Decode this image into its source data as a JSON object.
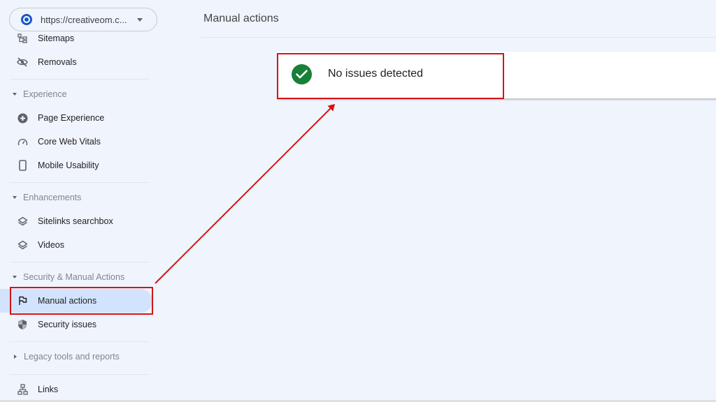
{
  "property": {
    "url": "https://creativeom.c...",
    "logo_icon": "property-logo-icon",
    "caret_icon": "caret-down-icon"
  },
  "sidebar": {
    "items_top": [
      {
        "label": "Sitemaps",
        "icon": "sitemap-icon"
      },
      {
        "label": "Removals",
        "icon": "eye-off-icon"
      }
    ],
    "sections": [
      {
        "title": "Experience",
        "expanded": true,
        "items": [
          {
            "label": "Page Experience",
            "icon": "plus-circle-icon"
          },
          {
            "label": "Core Web Vitals",
            "icon": "gauge-icon"
          },
          {
            "label": "Mobile Usability",
            "icon": "phone-icon"
          }
        ]
      },
      {
        "title": "Enhancements",
        "expanded": true,
        "items": [
          {
            "label": "Sitelinks searchbox",
            "icon": "layers-icon"
          },
          {
            "label": "Videos",
            "icon": "layers-icon"
          }
        ]
      },
      {
        "title": "Security & Manual Actions",
        "expanded": true,
        "items": [
          {
            "label": "Manual actions",
            "icon": "flag-icon",
            "active": true
          },
          {
            "label": "Security issues",
            "icon": "shield-icon"
          }
        ]
      },
      {
        "title": "Legacy tools and reports",
        "expanded": false,
        "items": []
      }
    ],
    "items_bottom": [
      {
        "label": "Links",
        "icon": "links-icon"
      }
    ]
  },
  "main": {
    "title": "Manual actions",
    "status": {
      "text": "No issues detected",
      "icon": "check-circle-icon",
      "color": "#188038"
    }
  },
  "annotations": {
    "highlight_color": "#d3141a"
  }
}
